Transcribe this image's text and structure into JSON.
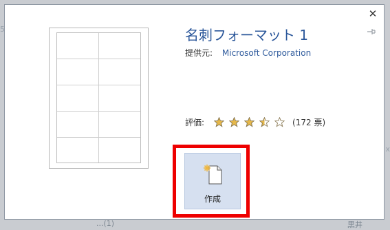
{
  "backdrop": {
    "left_text": "5",
    "right_text": "x",
    "bottom_left_text": "...(1)",
    "bottom_right_text": "黒井"
  },
  "dialog": {
    "title": "名刺フォーマット 1",
    "provider_label": "提供元:",
    "provider_value": "Microsoft Corporation",
    "rating_label": "評価:",
    "rating_value": 3.5,
    "rating_max": 5,
    "votes": "(172 票)",
    "create_label": "作成",
    "close_icon": "close-icon",
    "pin_icon": "pin-icon"
  },
  "colors": {
    "title": "#2b579a",
    "provider": "#2e5a9c",
    "highlight": "#ee0000",
    "create_bg": "#d6e0f0",
    "star_fill": "#e6b84a"
  }
}
